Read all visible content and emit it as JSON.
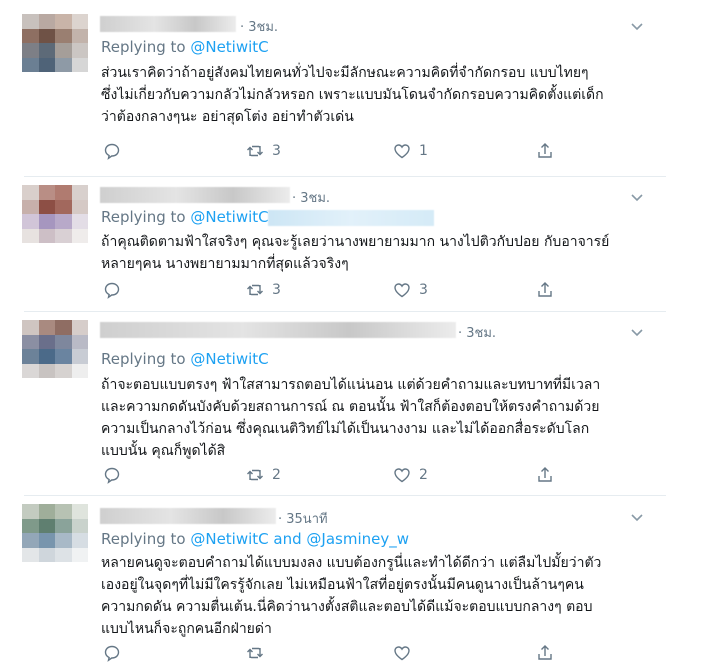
{
  "tweets": [
    {
      "time": "· 3ชม.",
      "replying_prefix": "Replying to ",
      "replying_to": "@NetiwitC",
      "replying_extra": "",
      "lines": [
        "ส่วนเราคิดว่าถ้าอยู่สังคมไทยคนทั่วไปจะมีลักษณะความคิดที่จำกัดกรอบ แบบไทยๆ",
        "ซึ่งไม่เกี่ยวกับความกลัวไม่กลัวหรอก เพราะแบบมันโดนจำกัดกรอบความคิดตั้งแต่เด็ก",
        "ว่าต้องกลางๆนะ อย่าสุดโต่ง อย่าทำตัวเด่น"
      ],
      "retweets": "3",
      "likes": "1"
    },
    {
      "time": "· 3ชม.",
      "replying_prefix": "Replying to ",
      "replying_to": "@NetiwitC",
      "replying_extra": "",
      "lines": [
        "ถ้าคุณติดตามฟ้าใสจริงๆ คุณจะรู้เลยว่านางพยายามมาก นางไปติวกับปอย กับอาจารย์",
        "หลายๆคน นางพยายามมากที่สุดแล้วจริงๆ"
      ],
      "retweets": "3",
      "likes": "3"
    },
    {
      "time": "· 3ชม.",
      "replying_prefix": "Replying to ",
      "replying_to": "@NetiwitC",
      "replying_extra": "",
      "lines": [
        "ถ้าจะตอบแบบตรงๆ ฟ้าใสสามารถตอบได้แน่นอน แต่ด้วยคำถามและบทบาทที่มีเวลา",
        "และความกดดันบังคับด้วยสถานการณ์ ณ ตอนนั้น ฟ้าใสก็ต้องตอบให้ตรงคำถามด้วย",
        "ความเป็นกลางไว้ก่อน ซึ่งคุณเนติวิทย์ไม่ได้เป็นนางงาม และไม่ได้ออกสื่อระดับโลก",
        "แบบนั้น คุณก็พูดได้สิ"
      ],
      "retweets": "2",
      "likes": "2"
    },
    {
      "time": "· 35นาที",
      "replying_prefix": "Replying to ",
      "replying_to": "@NetiwitC",
      "replying_extra": " and @Jasminey_w",
      "lines": [
        "หลายคนดูจะตอบคำถามได้แบบมงลง แบบต้องกรูนี่และทำได้ดีกว่า แต่ลืมไปมั้ยว่าตัว",
        "เองอยู่ในจุดๆที่ไม่มีใครรู้จักเลย ไม่เหมือนฟ้าใสที่อยู่ตรงนั้นมีคนดูนางเป็นล้านๆคน",
        "ความกดดัน ความตื่นเต้น.นี่คิดว่านางตั้งสติและตอบได้ดีแม้จะตอบแบบกลางๆ ตอบ",
        "แบบไหนก็จะถูกคนอีกฝ่ายด่า"
      ],
      "retweets": "",
      "likes": ""
    }
  ],
  "colors": {
    "accent": "#1da1f2",
    "muted": "#657786",
    "text": "#14171a",
    "divider": "#e6ecf0"
  },
  "icons": [
    "reply-icon",
    "retweet-icon",
    "like-icon",
    "share-icon",
    "chevron-down-icon"
  ]
}
